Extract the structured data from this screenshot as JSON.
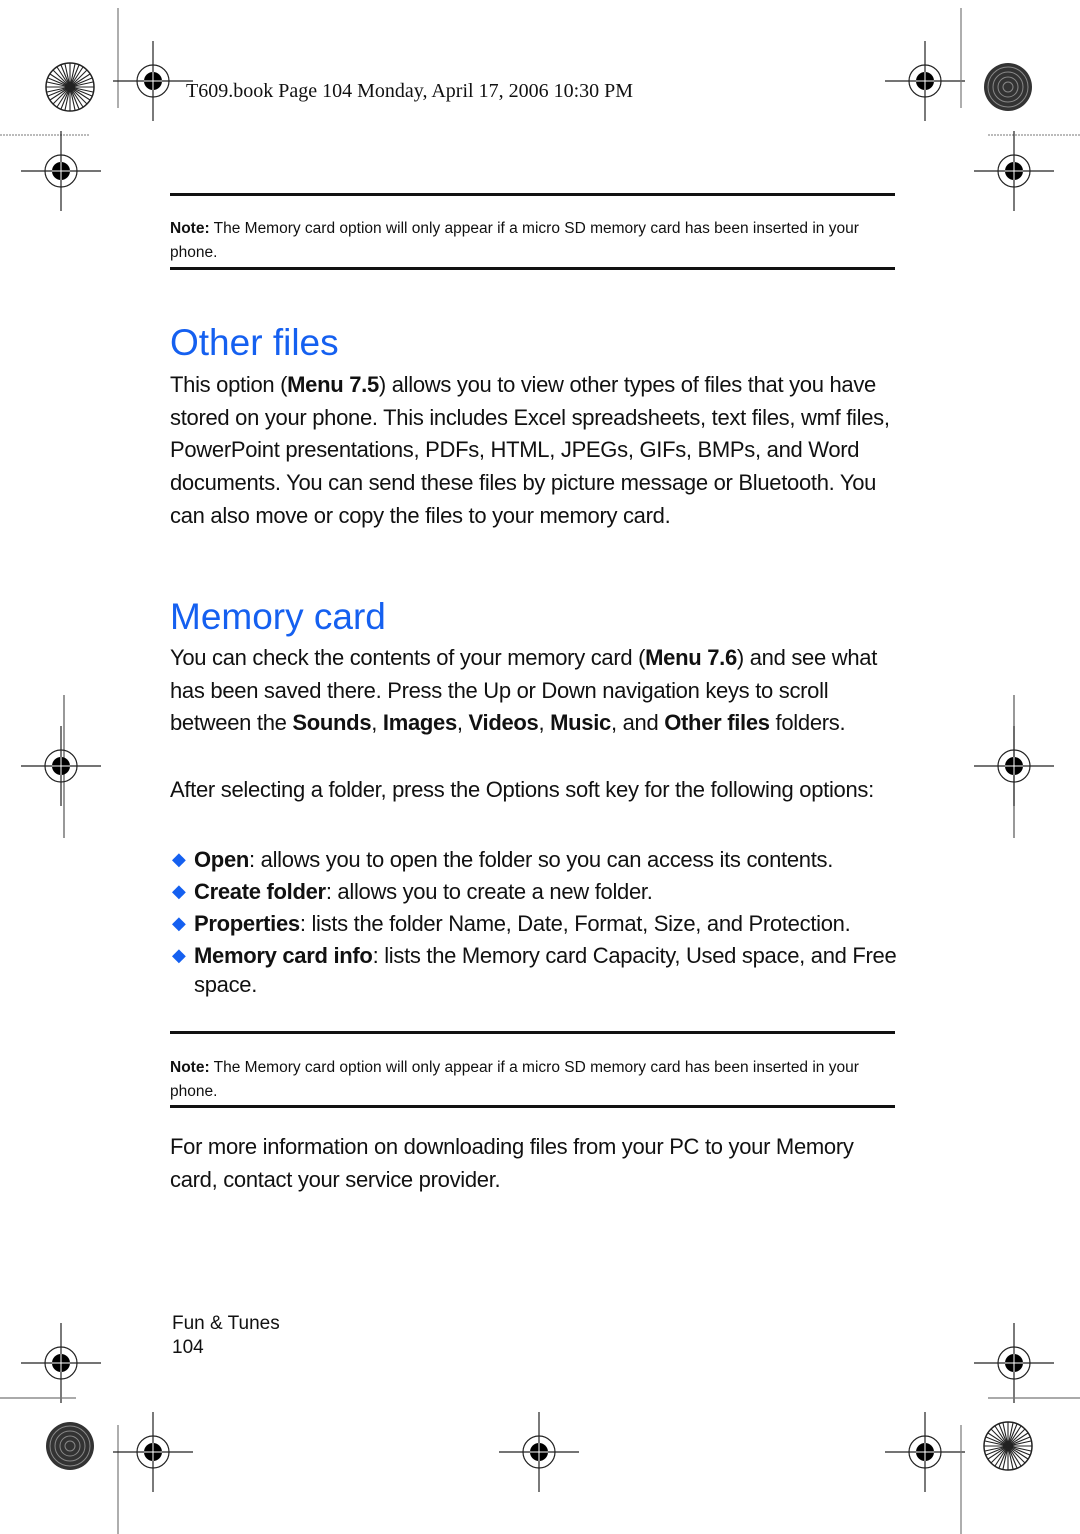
{
  "header": {
    "slug_text": "T609.book  Page 104  Monday, April 17, 2006  10:30 PM"
  },
  "notes": [
    {
      "label": "Note:",
      "text": " The Memory card option will only appear if a micro SD memory card has been inserted in your phone."
    },
    {
      "label": "Note:",
      "text": " The Memory card option will only appear if a micro SD memory card has been inserted in your phone."
    }
  ],
  "sections": {
    "other_files": {
      "heading": "Other files",
      "p_pre": "This option (",
      "p_bold": "Menu 7.5",
      "p_post": ") allows you to view other types of files that you have stored on your phone. This includes Excel spreadsheets, text files, wmf files, PowerPoint presentations, PDFs, HTML, JPEGs, GIFs, BMPs, and Word documents. You can send these files by picture message or Bluetooth. You can also move or copy the files to your memory card."
    },
    "memory_card": {
      "heading": "Memory card",
      "p1_a": "You can check the contents of your memory card (",
      "p1_menu": "Menu 7.6",
      "p1_b": ") and see what has been saved there. Press the Up or Down navigation keys to scroll between the ",
      "folders": [
        "Sounds",
        "Images",
        "Videos",
        "Music",
        "Other files"
      ],
      "sep1": ", ",
      "sep_and": ", and ",
      "p1_c": " folders.",
      "p2": "After selecting a folder, press the Options soft key for the following options:",
      "options": [
        {
          "name": "Open",
          "desc": ": allows you to open the folder so you can access its contents."
        },
        {
          "name": "Create folder",
          "desc": ": allows you to create a new folder."
        },
        {
          "name": "Properties",
          "desc": ": lists the folder Name, Date, Format, Size, and Protection."
        },
        {
          "name": "Memory card info",
          "desc": ": lists the Memory card Capacity, Used space, and Free space."
        }
      ],
      "bullet_glyph": "◆"
    },
    "closing": "For more information on downloading files from your PC to your Memory card, contact your service provider."
  },
  "footer": {
    "chapter": "Fun & Tunes",
    "page_number": "104"
  },
  "colors": {
    "heading_blue": "#1560f0",
    "text": "#111111"
  }
}
